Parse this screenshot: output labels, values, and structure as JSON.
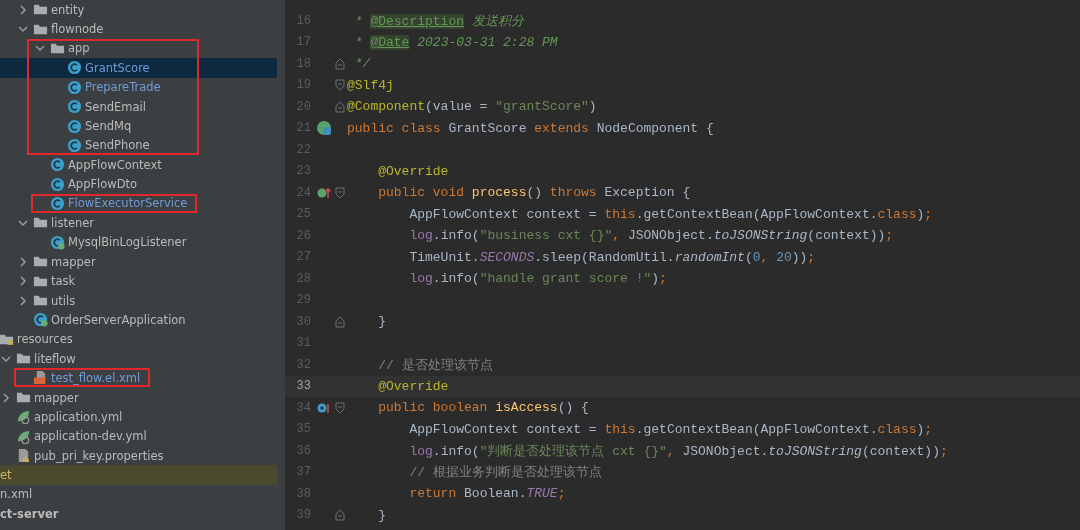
{
  "project_tree": {
    "package_items": [
      {
        "label": "entity",
        "kind": "folder",
        "expanded": false,
        "selected": false,
        "modified": false,
        "annotated": false
      },
      {
        "label": "flownode",
        "kind": "folder",
        "expanded": true,
        "selected": false,
        "modified": false,
        "annotated": false,
        "children": [
          {
            "label": "app",
            "kind": "folder",
            "expanded": true,
            "selected": false,
            "modified": false,
            "annotated": true,
            "children": [
              {
                "label": "GrantScore",
                "kind": "class",
                "selected": true,
                "modified": true,
                "annotated": false
              },
              {
                "label": "PrepareTrade",
                "kind": "class",
                "selected": false,
                "modified": true,
                "annotated": false
              },
              {
                "label": "SendEmail",
                "kind": "class",
                "selected": false,
                "modified": false,
                "annotated": false
              },
              {
                "label": "SendMq",
                "kind": "class",
                "selected": false,
                "modified": false,
                "annotated": false
              },
              {
                "label": "SendPhone",
                "kind": "class",
                "selected": false,
                "modified": false,
                "annotated": false
              }
            ]
          },
          {
            "label": "AppFlowContext",
            "kind": "class",
            "selected": false,
            "modified": false,
            "annotated": false
          },
          {
            "label": "AppFlowDto",
            "kind": "class",
            "selected": false,
            "modified": false,
            "annotated": false
          },
          {
            "label": "FlowExecutorService",
            "kind": "class",
            "selected": false,
            "modified": true,
            "annotated": true
          }
        ]
      },
      {
        "label": "listener",
        "kind": "folder",
        "expanded": true,
        "selected": false,
        "modified": false,
        "annotated": false,
        "children": [
          {
            "label": "MysqlBinLogListener",
            "kind": "spring_class",
            "selected": false,
            "modified": false,
            "annotated": false
          }
        ]
      },
      {
        "label": "mapper",
        "kind": "folder",
        "expanded": false,
        "selected": false,
        "modified": false,
        "annotated": false
      },
      {
        "label": "task",
        "kind": "folder",
        "expanded": false,
        "selected": false,
        "modified": false,
        "annotated": false
      },
      {
        "label": "utils",
        "kind": "folder",
        "expanded": false,
        "selected": false,
        "modified": false,
        "annotated": false
      },
      {
        "label": "OrderServerApplication",
        "kind": "spring_class",
        "selected": false,
        "modified": false,
        "annotated": false
      }
    ],
    "resource_items": [
      {
        "label": "resources",
        "kind": "resources_folder",
        "selected": false,
        "modified": false,
        "annotated": false,
        "children": [
          {
            "label": "liteflow",
            "kind": "folder",
            "expanded": true,
            "selected": false,
            "modified": false,
            "annotated": false,
            "children": [
              {
                "label": "test_flow.el.xml",
                "kind": "xml_file",
                "selected": false,
                "modified": true,
                "annotated": true
              }
            ]
          },
          {
            "label": "mapper",
            "kind": "folder",
            "expanded": false,
            "selected": false,
            "modified": false,
            "annotated": false
          },
          {
            "label": "application.yml",
            "kind": "yml_file",
            "selected": false,
            "modified": false,
            "annotated": false
          },
          {
            "label": "application-dev.yml",
            "kind": "yml_file",
            "selected": false,
            "modified": false,
            "annotated": false
          },
          {
            "label": "pub_pri_key.properties",
            "kind": "properties_file",
            "selected": false,
            "modified": false,
            "annotated": false
          }
        ]
      }
    ],
    "trailing_items": [
      {
        "label": "et",
        "kind": "excluded",
        "selected": false
      },
      {
        "label": "n.xml",
        "kind": "file",
        "selected": false
      },
      {
        "label": "ct-server",
        "kind": "module",
        "selected": false
      }
    ]
  },
  "editor": {
    "lines": [
      {
        "number": "16",
        "tokens": [
          {
            "kind": "doc",
            "text": " * "
          },
          {
            "kind": "doc_tag",
            "text": "@Description"
          },
          {
            "kind": "doc",
            "text": " 发送积分"
          }
        ]
      },
      {
        "number": "17",
        "tokens": [
          {
            "kind": "doc",
            "text": " * "
          },
          {
            "kind": "doc_tag",
            "text": "@Date"
          },
          {
            "kind": "doc",
            "text": " 2023-03-31 2:28 PM"
          }
        ]
      },
      {
        "number": "18",
        "fold": {
          "kind": "end"
        },
        "tokens": [
          {
            "kind": "doc",
            "text": " */"
          }
        ]
      },
      {
        "number": "19",
        "fold": {
          "kind": "start"
        },
        "tokens": [
          {
            "kind": "annotation",
            "text": "@Slf4j"
          }
        ]
      },
      {
        "number": "20",
        "fold": {
          "kind": "end"
        },
        "tokens": [
          {
            "kind": "annotation",
            "text": "@Component"
          },
          {
            "kind": "plain",
            "text": "(value = "
          },
          {
            "kind": "string",
            "text": "\"grantScore\""
          },
          {
            "kind": "plain",
            "text": ")"
          }
        ]
      },
      {
        "number": "21",
        "gutter_icon": {
          "kind": "bean"
        },
        "tokens": [
          {
            "kind": "keyword",
            "text": "public class "
          },
          {
            "kind": "plain",
            "text": "GrantScore "
          },
          {
            "kind": "keyword",
            "text": "extends "
          },
          {
            "kind": "plain",
            "text": "NodeComponent {"
          }
        ]
      },
      {
        "number": "22"
      },
      {
        "number": "23",
        "tokens": [
          {
            "kind": "annotation",
            "text": "    @Override"
          }
        ]
      },
      {
        "number": "24",
        "gutter_icon": {
          "kind": "overrides"
        },
        "fold": {
          "kind": "start"
        },
        "tokens": [
          {
            "kind": "keyword",
            "text": "    public void "
          },
          {
            "kind": "method",
            "text": "process"
          },
          {
            "kind": "plain",
            "text": "() "
          },
          {
            "kind": "keyword",
            "text": "throws "
          },
          {
            "kind": "plain",
            "text": "Exception {"
          }
        ]
      },
      {
        "number": "25",
        "tokens": [
          {
            "kind": "plain",
            "text": "        AppFlowContext context = "
          },
          {
            "kind": "keyword",
            "text": "this"
          },
          {
            "kind": "plain",
            "text": ".getContextBean(AppFlowContext."
          },
          {
            "kind": "keyword",
            "text": "class"
          },
          {
            "kind": "plain",
            "text": ")"
          },
          {
            "kind": "keyword",
            "text": ";"
          }
        ]
      },
      {
        "number": "26",
        "tokens": [
          {
            "kind": "field",
            "text": "        log"
          },
          {
            "kind": "plain",
            "text": ".info("
          },
          {
            "kind": "string",
            "text": "\"business cxt {}\""
          },
          {
            "kind": "keyword",
            "text": ", "
          },
          {
            "kind": "plain",
            "text": "JSONObject."
          },
          {
            "kind": "static_method",
            "text": "toJSONString"
          },
          {
            "kind": "plain",
            "text": "(context))"
          },
          {
            "kind": "keyword",
            "text": ";"
          }
        ]
      },
      {
        "number": "27",
        "tokens": [
          {
            "kind": "plain",
            "text": "        TimeUnit."
          },
          {
            "kind": "static_field",
            "text": "SECONDS"
          },
          {
            "kind": "plain",
            "text": ".sleep(RandomUtil."
          },
          {
            "kind": "static_method",
            "text": "randomInt"
          },
          {
            "kind": "plain",
            "text": "("
          },
          {
            "kind": "number",
            "text": "0"
          },
          {
            "kind": "keyword",
            "text": ", "
          },
          {
            "kind": "number",
            "text": "20"
          },
          {
            "kind": "plain",
            "text": "))"
          },
          {
            "kind": "keyword",
            "text": ";"
          }
        ]
      },
      {
        "number": "28",
        "tokens": [
          {
            "kind": "field",
            "text": "        log"
          },
          {
            "kind": "plain",
            "text": ".info("
          },
          {
            "kind": "string",
            "text": "\"handle grant score !\""
          },
          {
            "kind": "plain",
            "text": ")"
          },
          {
            "kind": "keyword",
            "text": ";"
          }
        ]
      },
      {
        "number": "29"
      },
      {
        "number": "30",
        "fold": {
          "kind": "end"
        },
        "tokens": [
          {
            "kind": "plain",
            "text": "    }"
          }
        ]
      },
      {
        "number": "31"
      },
      {
        "number": "32",
        "tokens": [
          {
            "kind": "comment",
            "text": "    // 是否处理该节点"
          }
        ]
      },
      {
        "number": "33",
        "current": true,
        "tokens": [
          {
            "kind": "annotation",
            "text": "    @Override"
          }
        ]
      },
      {
        "number": "34",
        "gutter_icon": {
          "kind": "implements"
        },
        "fold": {
          "kind": "start"
        },
        "tokens": [
          {
            "kind": "keyword",
            "text": "    public boolean "
          },
          {
            "kind": "method",
            "text": "isAccess"
          },
          {
            "kind": "plain",
            "text": "() {"
          }
        ]
      },
      {
        "number": "35",
        "tokens": [
          {
            "kind": "plain",
            "text": "        AppFlowContext context = "
          },
          {
            "kind": "keyword",
            "text": "this"
          },
          {
            "kind": "plain",
            "text": ".getContextBean(AppFlowContext."
          },
          {
            "kind": "keyword",
            "text": "class"
          },
          {
            "kind": "plain",
            "text": ")"
          },
          {
            "kind": "keyword",
            "text": ";"
          }
        ]
      },
      {
        "number": "36",
        "tokens": [
          {
            "kind": "field",
            "text": "        log"
          },
          {
            "kind": "plain",
            "text": ".info("
          },
          {
            "kind": "string",
            "text": "\"判断是否处理该节点 cxt {}\""
          },
          {
            "kind": "keyword",
            "text": ", "
          },
          {
            "kind": "plain",
            "text": "JSONObject."
          },
          {
            "kind": "static_method",
            "text": "toJSONString"
          },
          {
            "kind": "plain",
            "text": "(context))"
          },
          {
            "kind": "keyword",
            "text": ";"
          }
        ]
      },
      {
        "number": "37",
        "tokens": [
          {
            "kind": "comment",
            "text": "        // 根据业务判断是否处理该节点"
          }
        ]
      },
      {
        "number": "38",
        "tokens": [
          {
            "kind": "keyword",
            "text": "        return "
          },
          {
            "kind": "plain",
            "text": "Boolean."
          },
          {
            "kind": "static_field",
            "text": "TRUE"
          },
          {
            "kind": "keyword",
            "text": ";"
          }
        ]
      },
      {
        "number": "39",
        "fold": {
          "kind": "end"
        },
        "tokens": [
          {
            "kind": "plain",
            "text": "    }"
          }
        ]
      }
    ]
  }
}
